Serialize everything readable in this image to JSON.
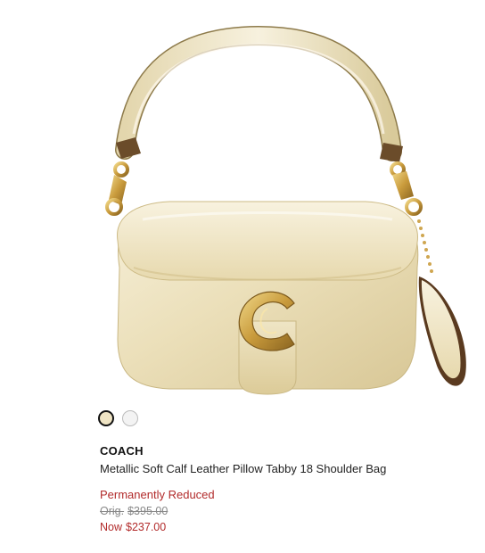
{
  "product": {
    "brand": "COACH",
    "title": "Metallic Soft Calf Leather Pillow Tabby 18 Shoulder Bag",
    "badge": "Permanently Reduced",
    "original_label": "Orig.",
    "original_price": "$395.00",
    "now_label": "Now",
    "now_price": "$237.00",
    "image_alt": "Metallic gold pillow shoulder bag",
    "swatches": [
      {
        "name": "Gold",
        "color": "#efe4c4",
        "selected": true
      },
      {
        "name": "Silver",
        "color": "#f3f3f3",
        "selected": false
      }
    ]
  },
  "colors": {
    "sale_red": "#b22b2b",
    "leather_gold": "#ece0bc",
    "hardware_gold": "#c9a24a"
  }
}
